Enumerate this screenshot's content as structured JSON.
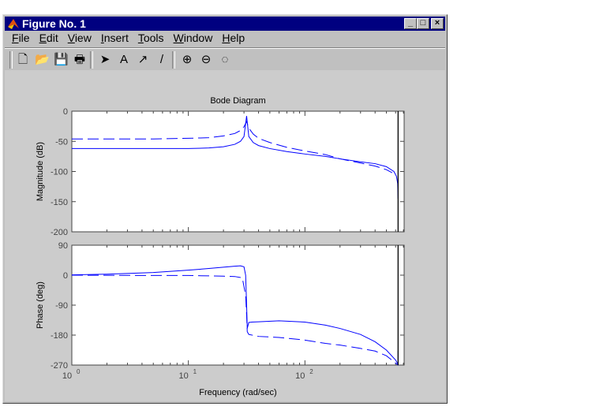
{
  "window": {
    "title": "Figure No. 1",
    "minimize": "_",
    "maximize": "□",
    "close": "×"
  },
  "menu": [
    "File",
    "Edit",
    "View",
    "Insert",
    "Tools",
    "Window",
    "Help"
  ],
  "toolbar": [
    {
      "name": "new-file-icon",
      "glyph": "🗋"
    },
    {
      "name": "open-file-icon",
      "glyph": "📂"
    },
    {
      "name": "save-icon",
      "glyph": "💾"
    },
    {
      "name": "print-icon",
      "glyph": "🖶"
    },
    {
      "name": "select-arrow-icon",
      "glyph": "➤"
    },
    {
      "name": "insert-text-icon",
      "glyph": "A"
    },
    {
      "name": "insert-arrow-icon",
      "glyph": "↗"
    },
    {
      "name": "insert-line-icon",
      "glyph": "/"
    },
    {
      "name": "zoom-in-icon",
      "glyph": "⊕"
    },
    {
      "name": "zoom-out-icon",
      "glyph": "⊖"
    },
    {
      "name": "rotate-icon",
      "glyph": "◌"
    }
  ],
  "colors": {
    "line": "#0000ff",
    "axes_bg": "#ffffff",
    "figure_bg": "#cccccc"
  },
  "chart_data": {
    "type": "line",
    "title": "Bode Diagram",
    "xlabel": "Frequency (rad/sec)",
    "xscale": "log",
    "xlim": [
      1,
      710
    ],
    "xticks": [
      {
        "base": "10",
        "exp": "0",
        "v": 1
      },
      {
        "base": "10",
        "exp": "1",
        "v": 10
      },
      {
        "base": "10",
        "exp": "2",
        "v": 100
      }
    ],
    "vline_x": 630,
    "magnitude": {
      "ylabel": "Magnitude (dB)",
      "ylim": [
        -200,
        0
      ],
      "yticks": [
        "0",
        "-50",
        "-100",
        "-150",
        "-200"
      ],
      "series": [
        {
          "name": "solid",
          "style": "solid",
          "x": [
            1,
            5,
            10,
            15,
            20,
            25,
            28,
            30,
            31.6,
            33,
            36,
            40,
            50,
            70,
            100,
            150,
            200,
            300,
            400,
            500,
            580,
            610,
            625,
            630
          ],
          "y": [
            -62,
            -62,
            -62,
            -61,
            -59,
            -55,
            -50,
            -42,
            -8,
            -42,
            -52,
            -57,
            -62,
            -67,
            -71,
            -75,
            -79,
            -84,
            -87,
            -92,
            -100,
            -108,
            -120,
            -145
          ]
        },
        {
          "name": "dashed",
          "style": "dashed",
          "x": [
            1,
            5,
            10,
            15,
            20,
            25,
            28,
            30,
            31.6,
            33,
            36,
            40,
            50,
            70,
            100,
            150,
            200,
            300,
            400,
            500,
            560
          ],
          "y": [
            -46,
            -46,
            -45,
            -44,
            -41,
            -37,
            -32,
            -26,
            -17,
            -28,
            -38,
            -45,
            -52,
            -60,
            -66,
            -72,
            -79,
            -86,
            -91,
            -97,
            -102
          ]
        }
      ]
    },
    "phase": {
      "ylabel": "Phase (deg)",
      "ylim": [
        -270,
        90
      ],
      "yticks": [
        "90",
        "0",
        "-90",
        "-180",
        "-270"
      ],
      "series": [
        {
          "name": "solid",
          "style": "solid",
          "x": [
            1,
            2,
            5,
            10,
            15,
            20,
            25,
            28,
            30,
            31,
            31.6,
            32,
            33,
            35,
            40,
            60,
            100,
            150,
            200,
            300,
            400,
            500,
            600,
            630,
            630
          ],
          "y": [
            1,
            3,
            8,
            15,
            20,
            24,
            27,
            28,
            25,
            0,
            -90,
            -160,
            -142,
            -141,
            -140,
            -137,
            -141,
            -150,
            -160,
            -178,
            -200,
            -225,
            -255,
            -268,
            -228
          ]
        },
        {
          "name": "dashed",
          "style": "dashed",
          "x": [
            1,
            5,
            10,
            20,
            25,
            29,
            31,
            31.6,
            32,
            33,
            40,
            60,
            100,
            150,
            200,
            300,
            400,
            500,
            630
          ],
          "y": [
            0,
            -1,
            -1,
            -3,
            -4,
            -8,
            -60,
            -120,
            -170,
            -178,
            -184,
            -187,
            -195,
            -205,
            -210,
            -220,
            -228,
            -242,
            -270
          ]
        }
      ]
    }
  }
}
